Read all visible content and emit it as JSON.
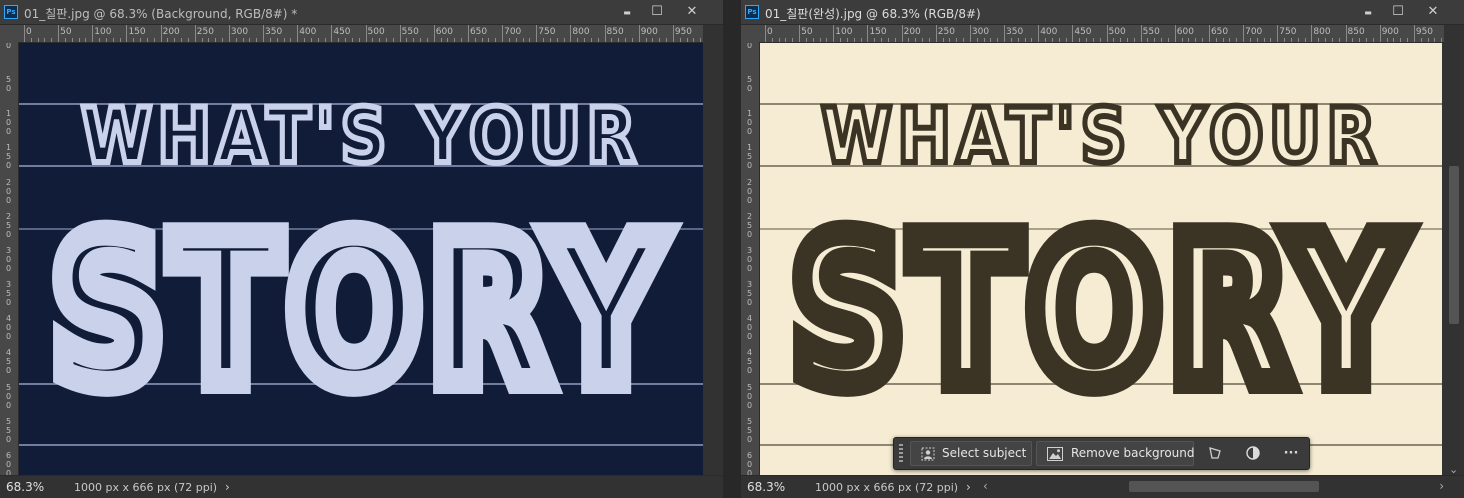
{
  "colors": {
    "chalkboard": "#14203d",
    "chalk": "#c9d2ea",
    "paper": "#f5ecd3",
    "ink": "#3b3424",
    "ps_blue": "#31a8ff"
  },
  "app_badge": "Ps",
  "left_doc": {
    "title": "01_칠판.jpg @ 68.3% (Background, RGB/8#) *",
    "zoom": "68.3%",
    "dims": "1000 px x 666 px (72 ppi)",
    "line1": "WHAT'S YOUR",
    "line2": "STORY"
  },
  "right_doc": {
    "title": "01_칠판(완성).jpg @ 68.3% (RGB/8#)",
    "zoom": "68.3%",
    "dims": "1000 px x 666 px (72 ppi)",
    "line1": "WHAT'S YOUR",
    "line2": "STORY"
  },
  "ruler_labels": [
    "0",
    "50",
    "100",
    "150",
    "200",
    "250",
    "300",
    "350",
    "400",
    "450",
    "500",
    "550",
    "600",
    "650",
    "700",
    "750",
    "800",
    "850",
    "900",
    "950"
  ],
  "vruler_labels": [
    "0",
    "5 0",
    "1 0 0",
    "1 5 0",
    "2 0 0",
    "2 5 0",
    "3 0 0",
    "3 5 0",
    "4 0 0",
    "4 5 0",
    "5 0 0",
    "5 5 0",
    "6 0 0"
  ],
  "window_controls": {
    "minimize": "▬",
    "maximize": "☐",
    "close": "✕"
  },
  "status_arrow": "›",
  "taskbar": {
    "select_subject": "Select subject",
    "remove_background": "Remove background",
    "more": "···"
  },
  "scroll_arrows": {
    "left": "‹",
    "right": "›",
    "down": "⌄"
  }
}
